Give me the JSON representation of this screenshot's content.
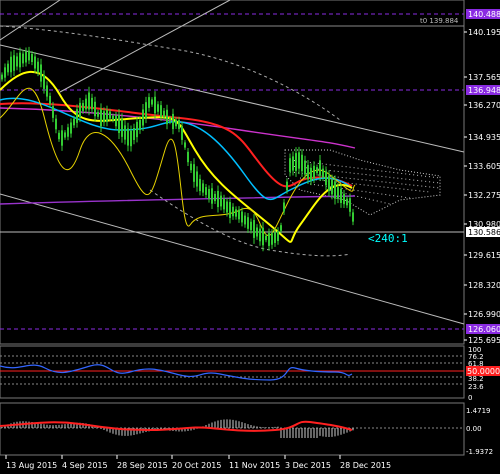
{
  "main": {
    "price_labels": [
      "140.195",
      "137.565",
      "136.270",
      "134.935",
      "133.605",
      "132.275",
      "130.980",
      "129.615",
      "128.320",
      "126.990",
      "125.695"
    ],
    "tags": {
      "level_top": "140.488",
      "crosshair_readout": "t0 139.884",
      "level_mid": "136.948",
      "current_price": "130.586",
      "level_bottom": "126.060"
    },
    "annotation": "<240:1"
  },
  "rsi": {
    "labels": [
      "100",
      "76.2",
      "61.8",
      "38.2",
      "23.6",
      "0"
    ],
    "tag": "50.0000"
  },
  "macd": {
    "labels": [
      "1.4719",
      "0.00",
      "-1.9372"
    ]
  },
  "x_axis": {
    "dates": [
      "13 Aug 2015",
      "4 Sep 2015",
      "28 Sep 2015",
      "20 Oct 2015",
      "11 Nov 2015",
      "3 Dec 2015",
      "28 Dec 2015"
    ]
  },
  "colors": {
    "background": "#000000",
    "candles": "#33cc33",
    "ma_yellow": "#ffff00",
    "ma_red": "#ff2020",
    "ma_cyan": "#00bfff",
    "ma_purple": "#cc33cc",
    "level_line": "#8a2be2",
    "rsi_line": "#3366ff",
    "macd_line": "#ff2020",
    "cloud": "#c8c8c8",
    "annotation": "#00ffff"
  }
}
